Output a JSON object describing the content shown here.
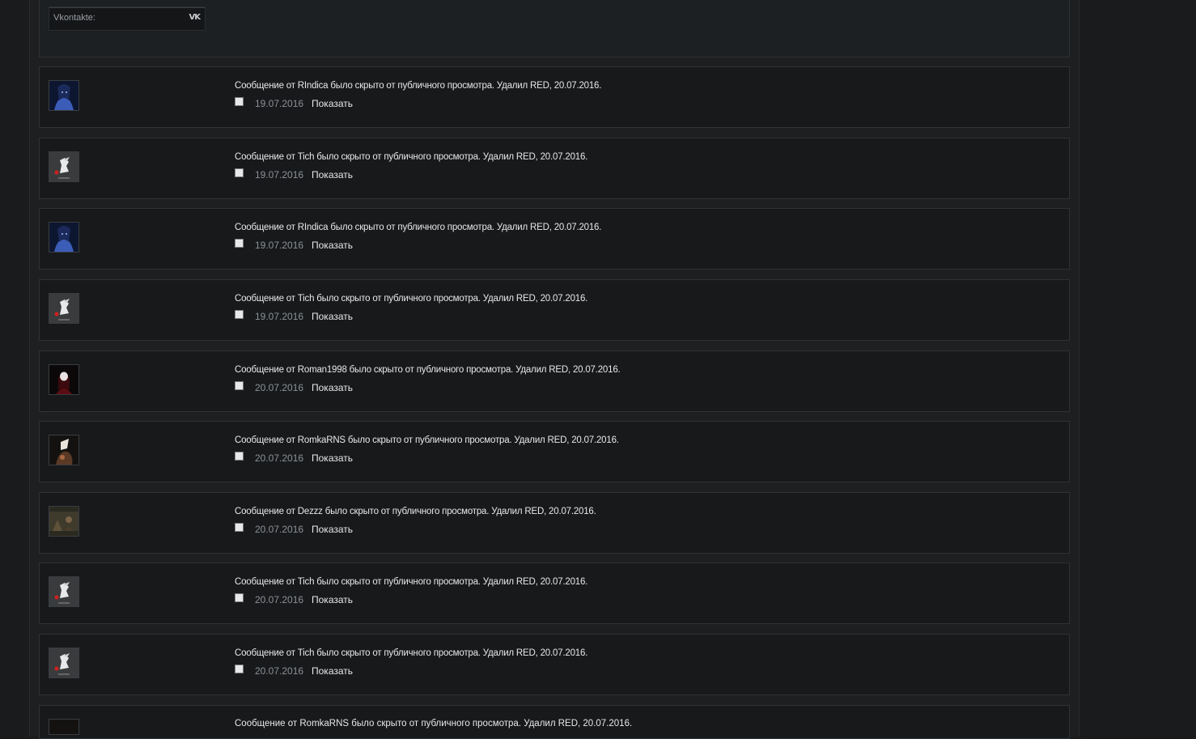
{
  "profile": {
    "vk_label": "Vkontakte:",
    "vk_icon": "vk-icon"
  },
  "posts": [
    {
      "message": "Сообщение от RIndica было скрыто от публичного просмотра. Удалил RED, 20.07.2016.",
      "date": "19.07.2016",
      "show": "Показать",
      "avatar": "rindica-avatar"
    },
    {
      "message": "Сообщение от Tich было скрыто от публичного просмотра. Удалил RED, 20.07.2016.",
      "date": "19.07.2016",
      "show": "Показать",
      "avatar": "tich-avatar"
    },
    {
      "message": "Сообщение от RIndica было скрыто от публичного просмотра. Удалил RED, 20.07.2016.",
      "date": "19.07.2016",
      "show": "Показать",
      "avatar": "rindica-avatar"
    },
    {
      "message": "Сообщение от Tich было скрыто от публичного просмотра. Удалил RED, 20.07.2016.",
      "date": "19.07.2016",
      "show": "Показать",
      "avatar": "tich-avatar"
    },
    {
      "message": "Сообщение от Roman1998 было скрыто от публичного просмотра. Удалил RED, 20.07.2016.",
      "date": "20.07.2016",
      "show": "Показать",
      "avatar": "roman1998-avatar"
    },
    {
      "message": "Сообщение от RomkaRNS было скрыто от публичного просмотра. Удалил RED, 20.07.2016.",
      "date": "20.07.2016",
      "show": "Показать",
      "avatar": "romkarns-avatar"
    },
    {
      "message": "Сообщение от Dezzz было скрыто от публичного просмотра. Удалил RED, 20.07.2016.",
      "date": "20.07.2016",
      "show": "Показать",
      "avatar": "dezzz-avatar"
    },
    {
      "message": "Сообщение от Tich было скрыто от публичного просмотра. Удалил RED, 20.07.2016.",
      "date": "20.07.2016",
      "show": "Показать",
      "avatar": "tich-avatar"
    },
    {
      "message": "Сообщение от Tich было скрыто от публичного просмотра. Удалил RED, 20.07.2016.",
      "date": "20.07.2016",
      "show": "Показать",
      "avatar": "tich-avatar"
    }
  ],
  "partial_post": {
    "message": "Сообщение от RomkaRNS было скрыто от публичного просмотра. Удалил RED, 20.07.2016."
  }
}
